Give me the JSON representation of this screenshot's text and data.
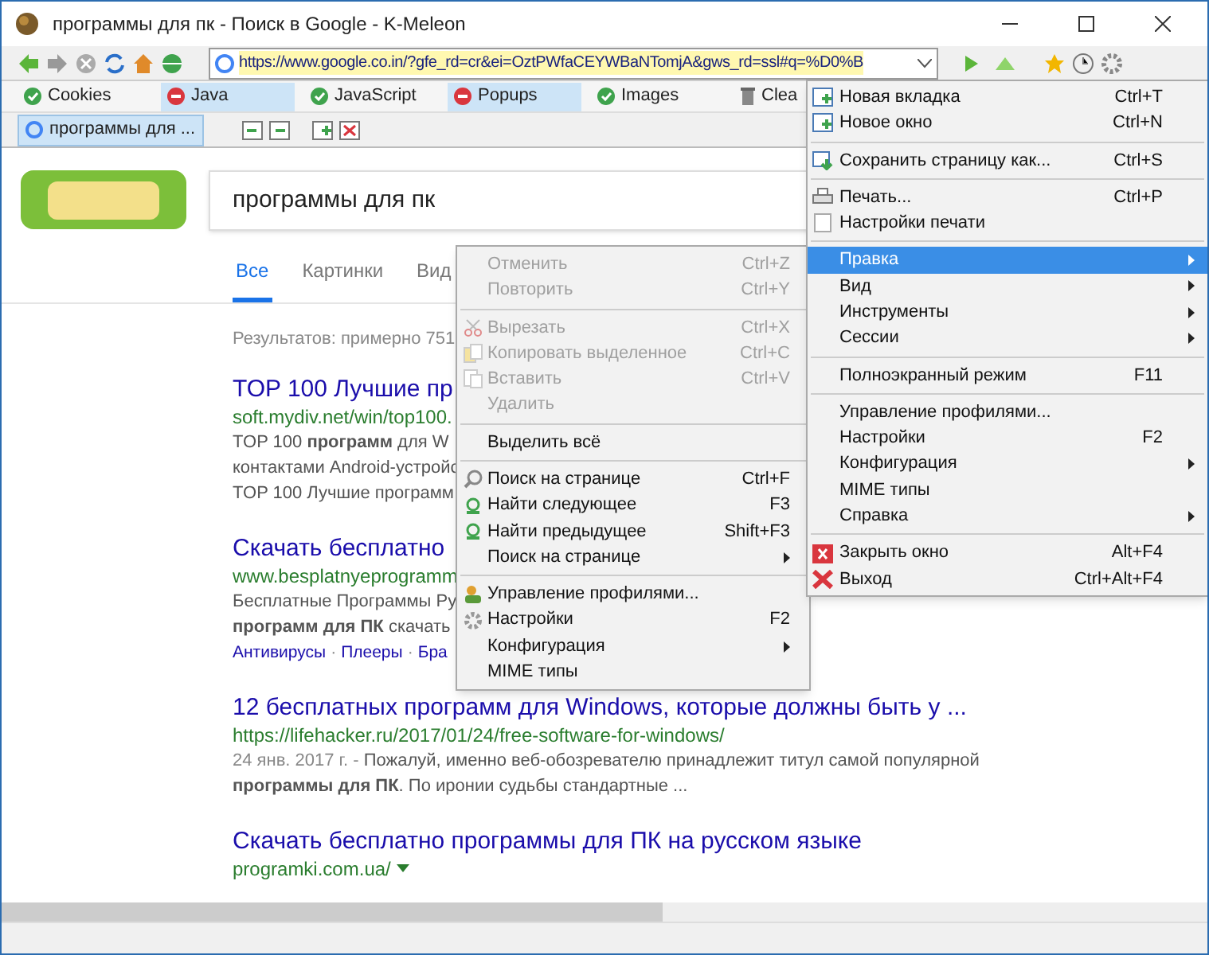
{
  "window": {
    "title": "программы для пк - Поиск в Google - K-Meleon"
  },
  "address_bar": {
    "url": "https://www.google.co.in/?gfe_rd=cr&ei=OztPWfaCEYWBaNTomjA&gws_rd=ssl#q=%D0%B"
  },
  "permissions": [
    {
      "label": "Cookies",
      "blocked": false
    },
    {
      "label": "Java",
      "blocked": true
    },
    {
      "label": "JavaScript",
      "blocked": false
    },
    {
      "label": "Popups",
      "blocked": true
    },
    {
      "label": "Images",
      "blocked": false
    }
  ],
  "clear_button": {
    "label": "Clea"
  },
  "tabs": [
    {
      "label": "программы для ...",
      "selected": true
    }
  ],
  "search": {
    "query": "программы для пк",
    "tabs": [
      {
        "label": "Все",
        "selected": true
      },
      {
        "label": "Картинки",
        "selected": false
      },
      {
        "label": "Вид",
        "selected": false
      }
    ],
    "result_count": "Результатов: примерно 751"
  },
  "results": [
    {
      "title": "TOP 100 Лучшие пр",
      "url": "soft.mydiv.net/win/top100.",
      "snippet": [
        "TOP 100 **программ** для W",
        "контактами Android-устройс",
        "TOP 100 Лучшие программ"
      ]
    },
    {
      "title": "Скачать бесплатно",
      "url": "www.besplatnyeprogramm",
      "snippet": [
        "Бесплатные Программы Ру",
        "**программ для ПК** скачать"
      ],
      "links": [
        "Антивирусы",
        "Плееры",
        "Бра"
      ],
      "link_separator": "·"
    },
    {
      "title": "12 бесплатных программ для Windows, которые должны быть у ...",
      "url": "https://lifehacker.ru/2017/01/24/free-software-for-windows/",
      "date": "24 янв. 2017 г. -",
      "snippet": [
        "Пожалуй, именно веб-обозревателю принадлежит титул самой популярной",
        "**программы для ПК**. По иронии судьбы стандартные ..."
      ]
    },
    {
      "title": "Скачать бесплатно программы для ПК на русском языке",
      "url": "programki.com.ua/"
    }
  ],
  "context_menu": [
    {
      "kind": "item",
      "label": "Отменить",
      "shortcut": "Ctrl+Z",
      "disabled": true,
      "submenu": false
    },
    {
      "kind": "item",
      "label": "Повторить",
      "shortcut": "Ctrl+Y",
      "disabled": true,
      "submenu": false
    },
    {
      "kind": "separator"
    },
    {
      "kind": "item",
      "label": "Вырезать",
      "shortcut": "Ctrl+X",
      "disabled": true,
      "submenu": false
    },
    {
      "kind": "item",
      "label": "Копировать выделенное",
      "shortcut": "Ctrl+C",
      "disabled": true,
      "submenu": false
    },
    {
      "kind": "item",
      "label": "Вставить",
      "shortcut": "Ctrl+V",
      "disabled": true,
      "submenu": false
    },
    {
      "kind": "item",
      "label": "Удалить",
      "disabled": true,
      "submenu": false
    },
    {
      "kind": "separator"
    },
    {
      "kind": "item",
      "label": "Выделить всё",
      "disabled": false,
      "submenu": false
    },
    {
      "kind": "separator"
    },
    {
      "kind": "item",
      "label": "Поиск на странице",
      "shortcut": "Ctrl+F",
      "disabled": false,
      "submenu": false
    },
    {
      "kind": "item",
      "label": "Найти следующее",
      "shortcut": "F3",
      "disabled": false,
      "submenu": false
    },
    {
      "kind": "item",
      "label": "Найти предыдущее",
      "shortcut": "Shift+F3",
      "disabled": false,
      "submenu": false
    },
    {
      "kind": "item",
      "label": "Поиск на странице",
      "disabled": false,
      "submenu": true
    },
    {
      "kind": "separator"
    },
    {
      "kind": "item",
      "label": "Управление профилями...",
      "disabled": false,
      "submenu": false
    },
    {
      "kind": "item",
      "label": "Настройки",
      "shortcut": "F2",
      "disabled": false,
      "submenu": false
    },
    {
      "kind": "item",
      "label": "Конфигурация",
      "disabled": false,
      "submenu": true
    },
    {
      "kind": "item",
      "label": "MIME типы",
      "disabled": false,
      "submenu": false
    }
  ],
  "main_menu": [
    {
      "kind": "item",
      "label": "Новая вкладка",
      "shortcut": "Ctrl+T",
      "selected": false,
      "submenu": false
    },
    {
      "kind": "item",
      "label": "Новое окно",
      "shortcut": "Ctrl+N",
      "selected": false,
      "submenu": false
    },
    {
      "kind": "separator"
    },
    {
      "kind": "item",
      "label": "Сохранить страницу как...",
      "shortcut": "Ctrl+S",
      "selected": false,
      "submenu": false
    },
    {
      "kind": "separator"
    },
    {
      "kind": "item",
      "label": "Печать...",
      "shortcut": "Ctrl+P",
      "selected": false,
      "submenu": false
    },
    {
      "kind": "item",
      "label": "Настройки печати",
      "selected": false,
      "submenu": false
    },
    {
      "kind": "separator"
    },
    {
      "kind": "item",
      "label": "Правка",
      "selected": true,
      "submenu": true
    },
    {
      "kind": "item",
      "label": "Вид",
      "selected": false,
      "submenu": true
    },
    {
      "kind": "item",
      "label": "Инструменты",
      "selected": false,
      "submenu": true
    },
    {
      "kind": "item",
      "label": "Сессии",
      "selected": false,
      "submenu": true
    },
    {
      "kind": "separator"
    },
    {
      "kind": "item",
      "label": "Полноэкранный режим",
      "shortcut": "F11",
      "selected": false,
      "submenu": false
    },
    {
      "kind": "separator"
    },
    {
      "kind": "item",
      "label": "Управление профилями...",
      "selected": false,
      "submenu": false
    },
    {
      "kind": "item",
      "label": "Настройки",
      "shortcut": "F2",
      "selected": false,
      "submenu": false
    },
    {
      "kind": "item",
      "label": "Конфигурация",
      "selected": false,
      "submenu": true
    },
    {
      "kind": "item",
      "label": "MIME типы",
      "selected": false,
      "submenu": false
    },
    {
      "kind": "item",
      "label": "Справка",
      "selected": false,
      "submenu": true
    },
    {
      "kind": "separator"
    },
    {
      "kind": "item",
      "label": "Закрыть окно",
      "shortcut": "Alt+F4",
      "selected": false,
      "submenu": false
    },
    {
      "kind": "item",
      "label": "Выход",
      "shortcut": "Ctrl+Alt+F4",
      "selected": false,
      "submenu": false
    }
  ]
}
